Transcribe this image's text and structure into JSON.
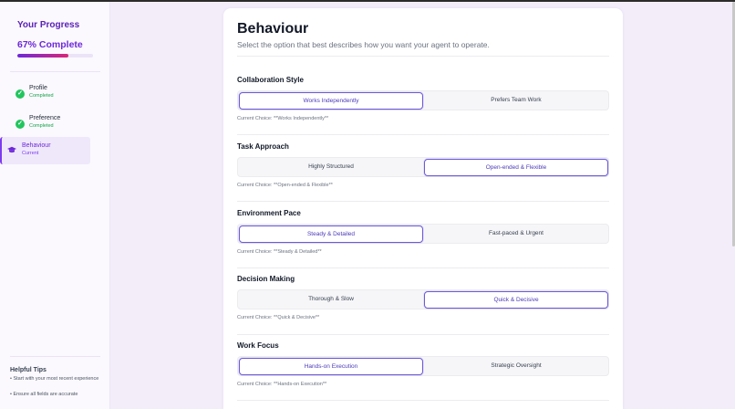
{
  "sidebar": {
    "progress_title": "Your Progress",
    "progress_label": "67% Complete",
    "progress_value": 0.67,
    "steps": [
      {
        "label": "Profile",
        "status": "Completed",
        "icon": "check-circle-icon"
      },
      {
        "label": "Preference",
        "status": "Completed",
        "icon": "check-circle-icon"
      },
      {
        "label": "Behaviour",
        "status": "Current",
        "icon": "graduation-cap-icon"
      }
    ],
    "tips_title": "Helpful Tips",
    "tips": [
      "• Start with your most recent experience",
      "• Ensure all fields are accurate"
    ]
  },
  "main": {
    "title": "Behaviour",
    "subtitle": "Select the option that best describes how you want your agent to operate.",
    "sections": [
      {
        "title": "Collaboration Style",
        "options": [
          "Works Independently",
          "Prefers Team Work"
        ],
        "selected": 0,
        "current": "Current Choice: **Works Independently**"
      },
      {
        "title": "Task Approach",
        "options": [
          "Highly Structured",
          "Open-ended & Flexible"
        ],
        "selected": 1,
        "current": "Current Choice: **Open-ended & Flexible**"
      },
      {
        "title": "Environment Pace",
        "options": [
          "Steady & Detailed",
          "Fast-paced & Urgent"
        ],
        "selected": 0,
        "current": "Current Choice: **Steady & Detailed**"
      },
      {
        "title": "Decision Making",
        "options": [
          "Thorough & Slow",
          "Quick & Decisive"
        ],
        "selected": 1,
        "current": "Current Choice: **Quick & Decisive**"
      },
      {
        "title": "Work Focus",
        "options": [
          "Hands-on Execution",
          "Strategic Oversight"
        ],
        "selected": 0,
        "current": "Current Choice: **Hands-on Execution**"
      }
    ]
  },
  "colors": {
    "accent": "#6d28d9",
    "success": "#22c55e",
    "progress_gradient_end": "#db2777",
    "background": "#f3edfa"
  }
}
